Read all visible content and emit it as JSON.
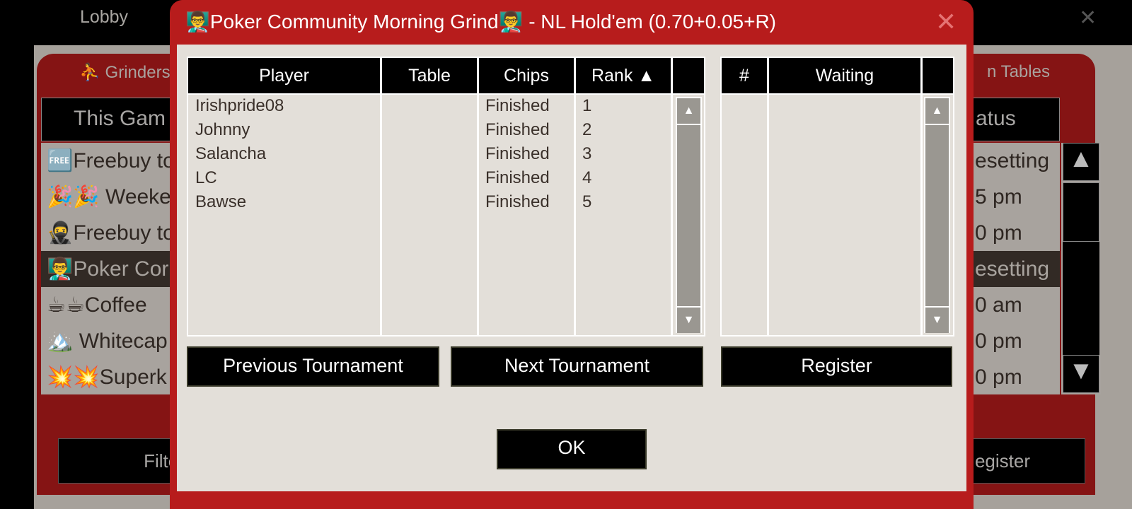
{
  "background": {
    "tab_label": "Lobby",
    "close_icon": "close-icon",
    "tabs": [
      "⛹ Grinders",
      "n Tables"
    ],
    "header": {
      "col1": "This Gam",
      "col2": "atus"
    },
    "rows": [
      {
        "name": "🆓Freebuy to",
        "status": "esetting"
      },
      {
        "name": "🎉🎉 Weeke",
        "status": "5 pm"
      },
      {
        "name": "🥷Freebuy to",
        "status": "0 pm"
      },
      {
        "name": "👨‍🏫Poker Cor",
        "status": "esetting",
        "selected": true
      },
      {
        "name": "☕☕Coffee",
        "status": "0 am"
      },
      {
        "name": "🏔️ Whitecap",
        "status": "0 pm"
      },
      {
        "name": "💥💥Superk",
        "status": "0 pm"
      }
    ],
    "buttons": {
      "filter": "Filter",
      "register": "egister"
    }
  },
  "dialog": {
    "title": "👨‍🏫Poker Community Morning Grind👨‍🏫 - NL Hold'em (0.70+0.05+R)",
    "close_icon": "close-icon",
    "players_table": {
      "headers": {
        "player": "Player",
        "table": "Table",
        "chips": "Chips",
        "rank": "Rank ▲"
      },
      "rows": [
        {
          "player": "Irishpride08",
          "table": "",
          "chips": "Finished",
          "rank": "1"
        },
        {
          "player": "Johnny",
          "table": "",
          "chips": "Finished",
          "rank": "2"
        },
        {
          "player": "Salancha",
          "table": "",
          "chips": "Finished",
          "rank": "3"
        },
        {
          "player": "LC",
          "table": "",
          "chips": "Finished",
          "rank": "4"
        },
        {
          "player": "Bawse",
          "table": "",
          "chips": "Finished",
          "rank": "5"
        }
      ]
    },
    "waiting_table": {
      "headers": {
        "num": "#",
        "waiting": "Waiting"
      },
      "rows": []
    },
    "buttons": {
      "previous": "Previous Tournament",
      "next": "Next Tournament",
      "register": "Register",
      "ok": "OK"
    }
  },
  "colors": {
    "dialog_red": "#b71c1c",
    "content_bg": "#e3dfd9",
    "header_bg": "#000000"
  }
}
